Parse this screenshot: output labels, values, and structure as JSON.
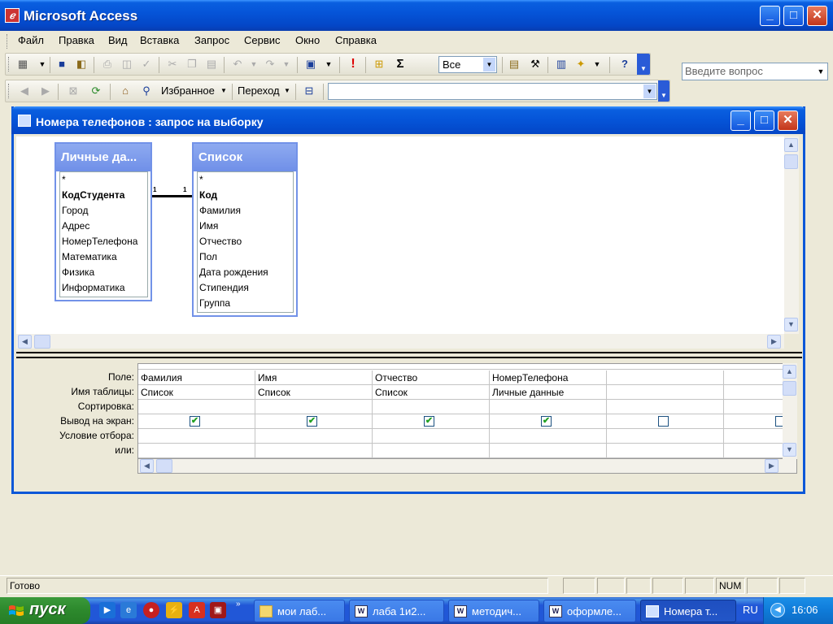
{
  "app": {
    "title": "Microsoft Access"
  },
  "menu": {
    "items": [
      "Файл",
      "Правка",
      "Вид",
      "Вставка",
      "Запрос",
      "Сервис",
      "Окно",
      "Справка"
    ],
    "help_placeholder": "Введите вопрос"
  },
  "toolbar1": {
    "top_values": "Все",
    "sigma": "Σ",
    "run": "!"
  },
  "toolbar2": {
    "favorites": "Избранное",
    "goto": "Переход",
    "address": ""
  },
  "query_window": {
    "title": "Номера телефонов : запрос на выборку",
    "tables": [
      {
        "name": "Личные да...",
        "fields": [
          "*",
          "КодСтудента",
          "Город",
          "Адрес",
          "НомерТелефона",
          "Математика",
          "Физика",
          "Информатика"
        ],
        "pk": "КодСтудента"
      },
      {
        "name": "Список",
        "fields": [
          "*",
          "Код",
          "Фамилия",
          "Имя",
          "Отчество",
          "Пол",
          "Дата рождения",
          "Стипендия",
          "Группа"
        ],
        "pk": "Код"
      }
    ],
    "relation": {
      "left": "1",
      "right": "1"
    },
    "row_labels": [
      "Поле:",
      "Имя таблицы:",
      "Сортировка:",
      "Вывод на экран:",
      "Условие отбора:",
      "или:"
    ],
    "columns": [
      {
        "field": "Фамилия",
        "table": "Список",
        "show": true
      },
      {
        "field": "Имя",
        "table": "Список",
        "show": true
      },
      {
        "field": "Отчество",
        "table": "Список",
        "show": true
      },
      {
        "field": "НомерТелефона",
        "table": "Личные данные",
        "show": true
      },
      {
        "field": "",
        "table": "",
        "show": false
      },
      {
        "field": "",
        "table": "",
        "show": false
      }
    ]
  },
  "status": {
    "text": "Готово",
    "num": "NUM"
  },
  "taskbar": {
    "start": "пуск",
    "tasks": [
      "мои лаб...",
      "лаба 1и2...",
      "методич...",
      "оформле...",
      "Номера т..."
    ],
    "lang": "RU",
    "clock": "16:06"
  },
  "colors": {
    "titlebar": "#0554d8",
    "taskbar": "#2157d7",
    "start": "#2e8b2e",
    "check": "#21a121"
  }
}
